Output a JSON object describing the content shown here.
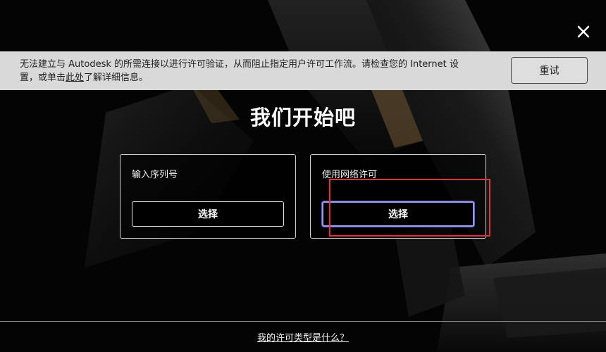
{
  "banner": {
    "message_part1": "无法建立与 Autodesk 的所需连接以进行许可验证，从而阻止指定用户许可工作流。请检查您的 Internet 设置，或单击",
    "link_text": "此处",
    "message_part2": "了解详细信息。",
    "retry_label": "重试"
  },
  "title": "我们开始吧",
  "options": [
    {
      "label": "输入序列号",
      "button_label": "选择"
    },
    {
      "label": "使用网络许可",
      "button_label": "选择"
    }
  ],
  "footer": {
    "link_text": "我的许可类型是什么？"
  },
  "icons": {
    "close": "close-icon"
  },
  "colors": {
    "background": "#050505",
    "banner_bg": "#d9d9d9",
    "highlight": "#e0343a",
    "focus_ring": "#9a9ce8"
  }
}
